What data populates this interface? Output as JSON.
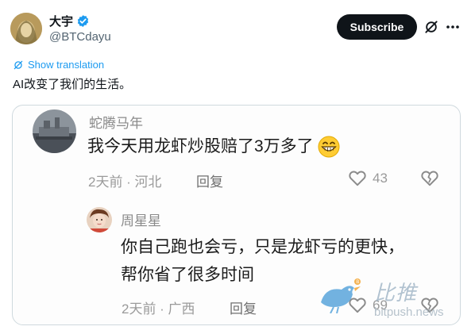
{
  "author": {
    "display_name": "大宇",
    "handle": "@BTCdayu",
    "verified": true
  },
  "actions": {
    "subscribe_label": "Subscribe",
    "grok_icon": "grok-icon",
    "more_icon": "more-icon"
  },
  "translate": {
    "label": "Show translation"
  },
  "tweet": {
    "text": "AI改变了我们的生活。"
  },
  "screenshot": {
    "comment": {
      "user": "蛇腾马年",
      "text": "我今天用龙虾炒股赔了3万多了",
      "emoji": "grinning-face-emoji",
      "time_location": "2天前 · 河北",
      "reply_label": "回复",
      "likes": "43"
    },
    "reply": {
      "user": "周星星",
      "text_line1": "你自己跑也会亏，只是龙虾亏的更快，",
      "text_line2": "帮你省了很多时间",
      "time_location": "2天前 · 广西",
      "reply_label": "回复",
      "likes": "69"
    },
    "watermark": {
      "brand": "比推",
      "url": "bitpush.news"
    }
  },
  "colors": {
    "accent": "#1d9bf0",
    "text": "#0f1419",
    "muted": "#536471",
    "button_bg": "#0f1419"
  }
}
